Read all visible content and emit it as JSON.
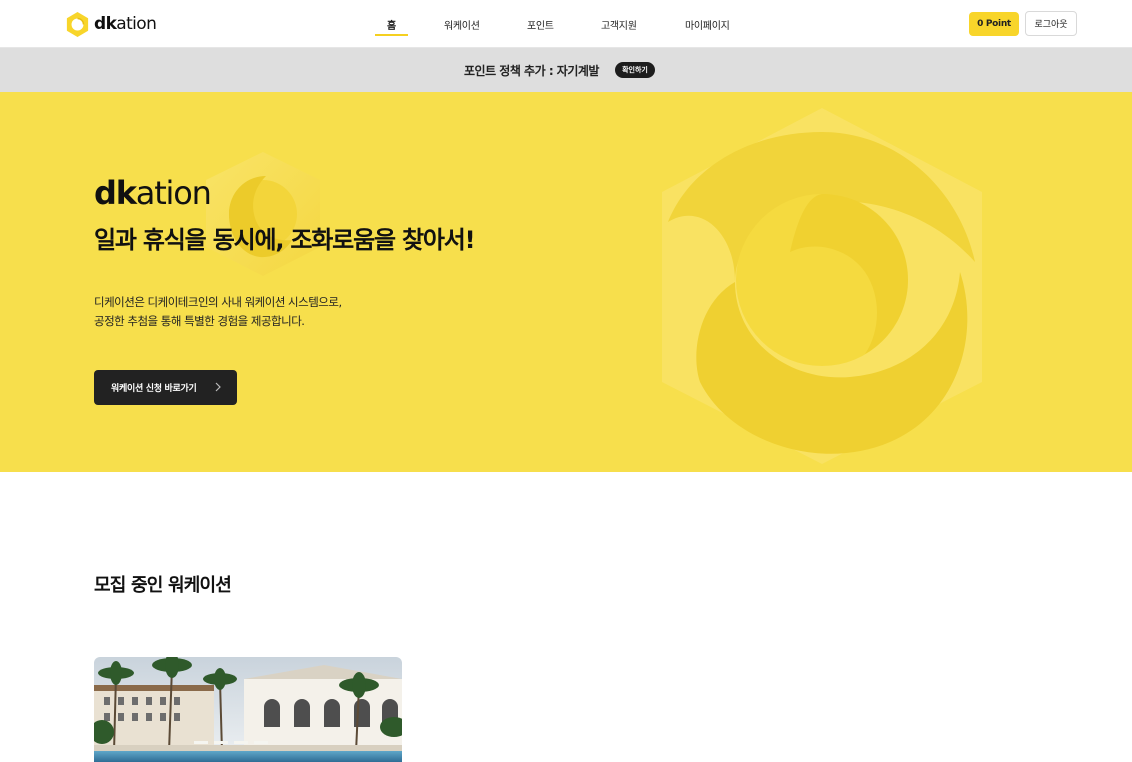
{
  "header": {
    "logo_text_bold": "dk",
    "logo_text_rest": "ation",
    "nav": [
      {
        "label": "홈",
        "active": true
      },
      {
        "label": "워케이션",
        "active": false
      },
      {
        "label": "포인트",
        "active": false
      },
      {
        "label": "고객지원",
        "active": false
      },
      {
        "label": "마이페이지",
        "active": false
      }
    ],
    "point_label": "0 Point",
    "logout_label": "로그아웃"
  },
  "notice": {
    "text": "포인트 정책 추가 : 자기계발",
    "button_label": "확인하기"
  },
  "hero": {
    "logo_bold": "dk",
    "logo_rest": "ation",
    "title": "일과 휴식을 동시에, 조화로움을 찾아서!",
    "desc_line1": "디케이션은 디케이테크인의 사내 워케이션 시스템으로,",
    "desc_line2": "공정한 추첨을 통해 특별한 경험을 제공합니다.",
    "cta_label": "워케이션 신청 바로가기"
  },
  "section": {
    "title": "모집 중인 워케이션"
  },
  "colors": {
    "brand_yellow": "#f7df4c",
    "accent_yellow": "#f8d52a",
    "dark": "#222222",
    "notice_bg": "#dedede"
  },
  "icons": {
    "logo": "dkation-logo-mark",
    "cta": "chevron-right-icon"
  }
}
